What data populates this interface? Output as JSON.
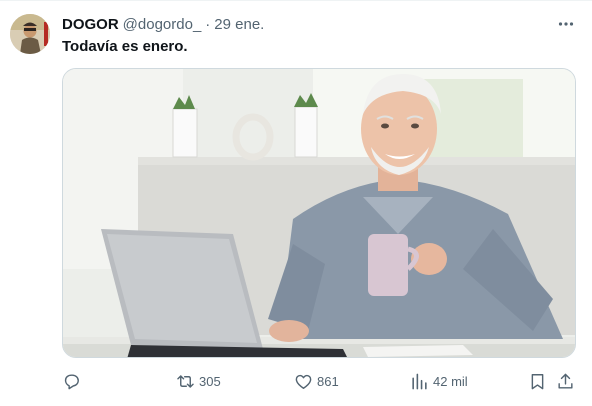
{
  "tweet": {
    "author_name": "DOGOR",
    "handle": "@dogordo_",
    "separator": "·",
    "time": "29 ene.",
    "text": "Todavía es enero."
  },
  "icons": {
    "more": "more-dots-icon",
    "reply": "reply-icon",
    "retweet": "retweet-icon",
    "like": "heart-icon",
    "views": "views-chart-icon",
    "bookmark": "bookmark-icon",
    "share": "share-icon"
  },
  "actions": {
    "reply_count": "",
    "retweet_count": "305",
    "like_count": "861",
    "views_count": "42 mil"
  },
  "colors": {
    "text_primary": "#0f1419",
    "text_secondary": "#536471",
    "border": "#cfd9de"
  }
}
